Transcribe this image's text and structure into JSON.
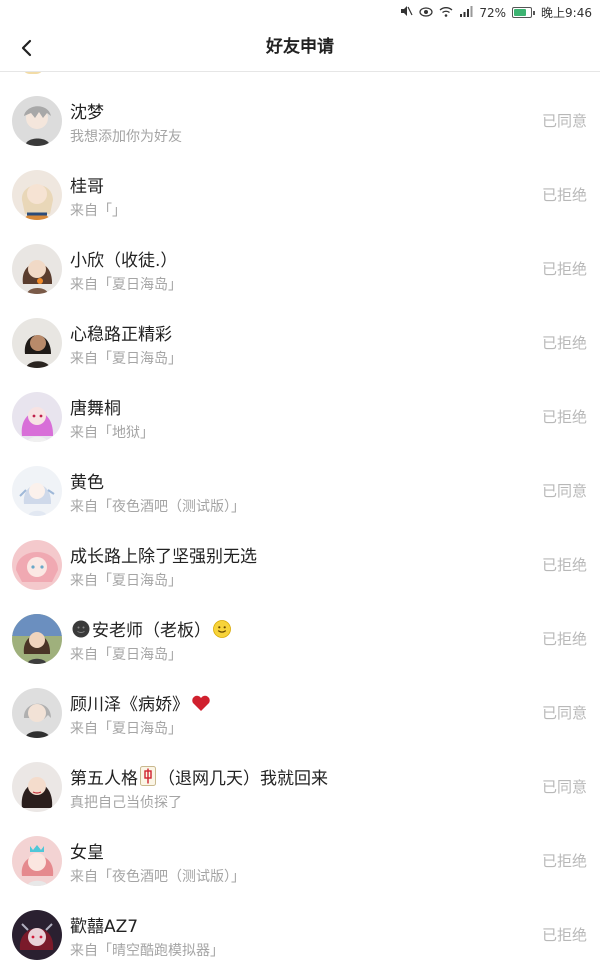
{
  "status_bar": {
    "battery_percent": "72%",
    "battery_level": 0.72,
    "time": "晚上9:46",
    "icons": [
      "mute-icon",
      "eye-icon",
      "wifi-icon",
      "signal-icon",
      "battery-icon"
    ]
  },
  "header": {
    "title": "好友申请",
    "back_icon": "chevron-left-icon"
  },
  "requests": [
    {
      "name": "沈梦",
      "sub": "我想添加你为好友",
      "status": "已同意",
      "avatar_color": "#dcdcdc"
    },
    {
      "name": "桂哥",
      "sub": "来自「」",
      "status": "已拒绝",
      "avatar_color": "#efe7df"
    },
    {
      "name": "小欣（收徒.）",
      "sub": "来自「夏日海岛」",
      "status": "已拒绝",
      "avatar_color": "#e9e6e3"
    },
    {
      "name": "心稳路正精彩",
      "sub": "来自「夏日海岛」",
      "status": "已拒绝",
      "avatar_color": "#e8e6e2"
    },
    {
      "name": "唐舞桐",
      "sub": "来自「地狱」",
      "status": "已拒绝",
      "avatar_color": "#e8e4ee"
    },
    {
      "name": "黄色",
      "sub": "来自「夜色酒吧（测试版）」",
      "status": "已同意",
      "avatar_color": "#f0f3f7"
    },
    {
      "name": "成长路上除了坚强别无选",
      "sub": "来自「夏日海岛」",
      "status": "已拒绝",
      "avatar_color": "#f4c9cc"
    },
    {
      "name": "安老师（老板）",
      "sub": "来自「夏日海岛」",
      "status": "已拒绝",
      "avatar_color": "#9fb07c",
      "prefix_icon": "dark-face-icon",
      "suffix_icon": "smile-icon"
    },
    {
      "name": "顾川泽《病娇》",
      "sub": "来自「夏日海岛」",
      "status": "已同意",
      "avatar_color": "#dedede",
      "suffix_icon": "red-heart-icon"
    },
    {
      "name_before": "第五人格",
      "name_after": "（退网几天）我就回来",
      "sub": "真把自己当侦探了",
      "status": "已同意",
      "avatar_color": "#ebe7e5",
      "inline_icon": "mahjong-tile-icon"
    },
    {
      "name": "女皇",
      "sub": "来自「夜色酒吧（测试版）」",
      "status": "已拒绝",
      "avatar_color": "#f3d3d3"
    },
    {
      "name": "歡囍AZ7",
      "sub": "来自「晴空酷跑模拟器」",
      "status": "已拒绝",
      "avatar_color": "#2a2030"
    }
  ]
}
